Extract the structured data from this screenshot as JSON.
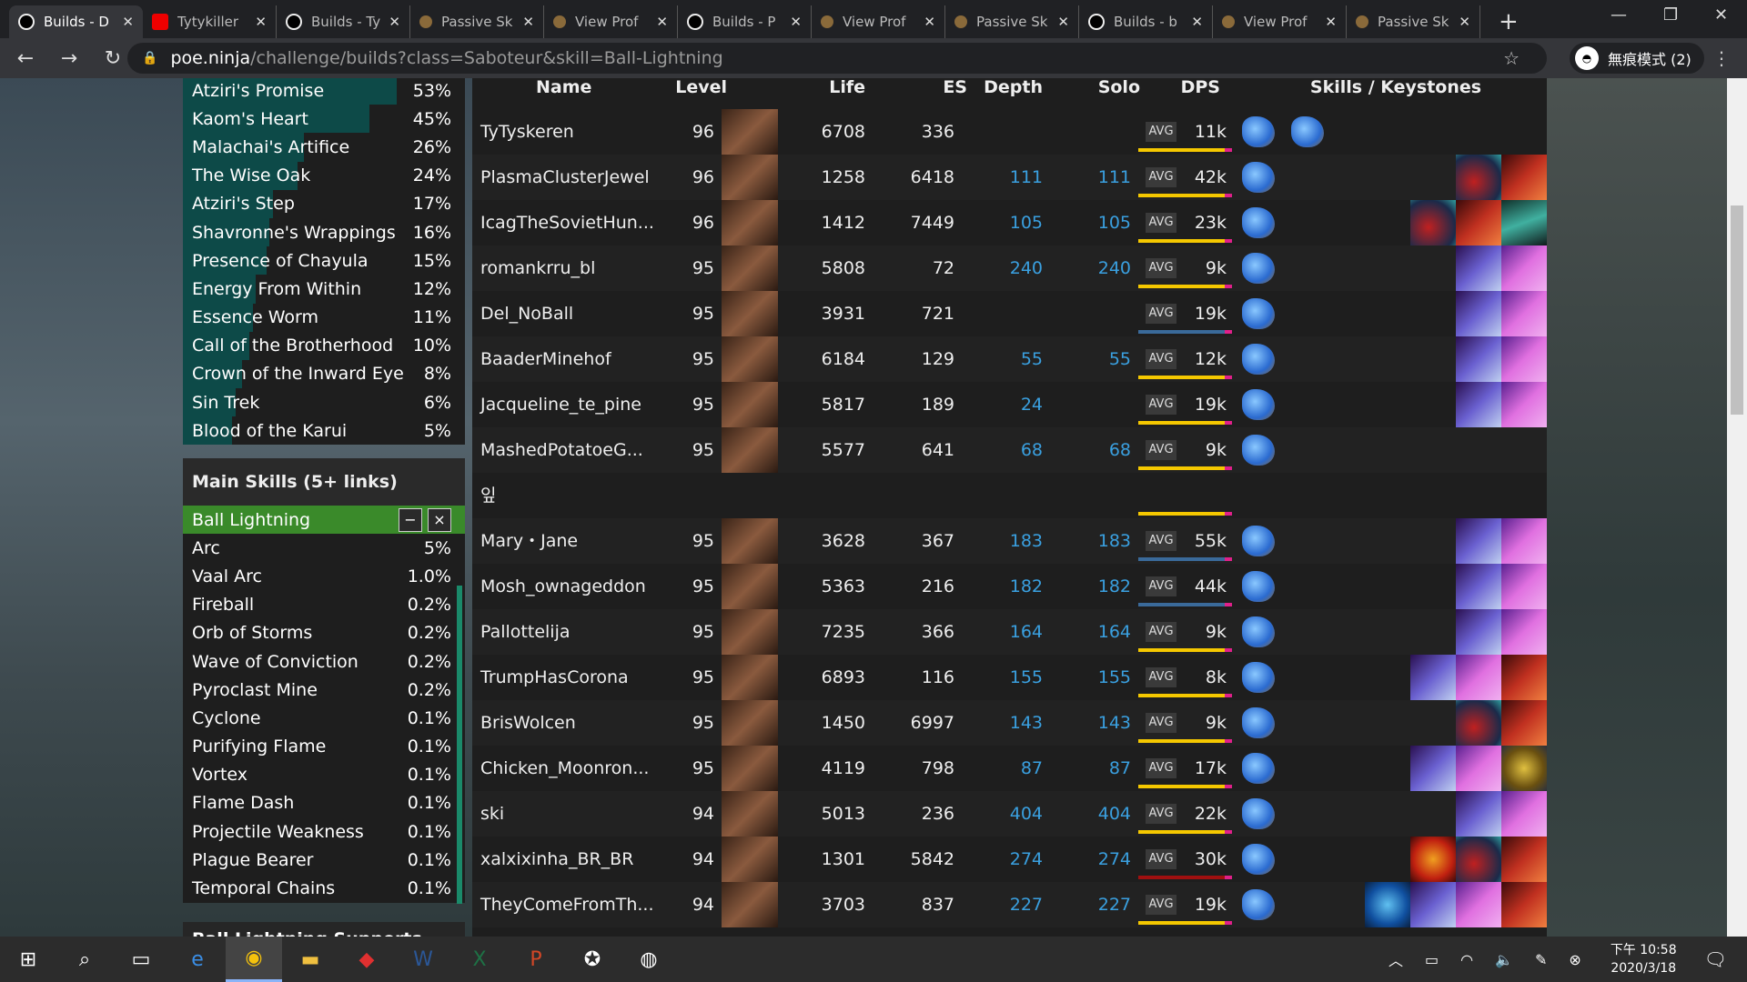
{
  "browser": {
    "tabs": [
      {
        "title": "Builds - D",
        "icon": "poe-ninja",
        "active": true
      },
      {
        "title": "Tytykiller",
        "icon": "youtube"
      },
      {
        "title": "Builds - Ty",
        "icon": "poe-ninja"
      },
      {
        "title": "Passive Sk",
        "icon": "poe"
      },
      {
        "title": "View Prof",
        "icon": "poe"
      },
      {
        "title": "Builds - P",
        "icon": "poe-ninja"
      },
      {
        "title": "View Prof",
        "icon": "poe"
      },
      {
        "title": "Passive Sk",
        "icon": "poe"
      },
      {
        "title": "Builds - b",
        "icon": "poe-ninja"
      },
      {
        "title": "View Prof",
        "icon": "poe"
      },
      {
        "title": "Passive Sk",
        "icon": "poe"
      }
    ],
    "url_host": "poe.ninja",
    "url_path": "/challenge/builds?class=Saboteur&skill=Ball-Lightning",
    "incognito_label": "無痕模式 (2)"
  },
  "uniques": [
    {
      "name": "Atziri's Promise",
      "pct": "53%"
    },
    {
      "name": "Kaom's Heart",
      "pct": "45%"
    },
    {
      "name": "Malachai's Artifice",
      "pct": "26%"
    },
    {
      "name": "The Wise Oak",
      "pct": "24%"
    },
    {
      "name": "Atziri's Step",
      "pct": "17%"
    },
    {
      "name": "Shavronne's Wrappings",
      "pct": "16%"
    },
    {
      "name": "Presence of Chayula",
      "pct": "15%"
    },
    {
      "name": "Energy From Within",
      "pct": "12%"
    },
    {
      "name": "Essence Worm",
      "pct": "11%"
    },
    {
      "name": "Call of the Brotherhood",
      "pct": "10%"
    },
    {
      "name": "Crown of the Inward Eye",
      "pct": "8%"
    },
    {
      "name": "Sin Trek",
      "pct": "6%"
    },
    {
      "name": "Blood of the Karui",
      "pct": "5%"
    }
  ],
  "main_skills": {
    "title": "Main Skills (5+ links)",
    "selected": "Ball Lightning",
    "minus": "−",
    "close": "×",
    "items": [
      {
        "name": "Arc",
        "pct": "5%"
      },
      {
        "name": "Vaal Arc",
        "pct": "1.0%"
      },
      {
        "name": "Fireball",
        "pct": "0.2%"
      },
      {
        "name": "Orb of Storms",
        "pct": "0.2%"
      },
      {
        "name": "Wave of Conviction",
        "pct": "0.2%"
      },
      {
        "name": "Pyroclast Mine",
        "pct": "0.2%"
      },
      {
        "name": "Cyclone",
        "pct": "0.1%"
      },
      {
        "name": "Purifying Flame",
        "pct": "0.1%"
      },
      {
        "name": "Vortex",
        "pct": "0.1%"
      },
      {
        "name": "Flame Dash",
        "pct": "0.1%"
      },
      {
        "name": "Projectile Weakness",
        "pct": "0.1%"
      },
      {
        "name": "Plague Bearer",
        "pct": "0.1%"
      },
      {
        "name": "Temporal Chains",
        "pct": "0.1%"
      }
    ]
  },
  "supports_title": "Ball Lightning Supports",
  "table": {
    "headers": [
      "Name",
      "Level",
      "Life",
      "ES",
      "Depth",
      "Solo",
      "DPS",
      "Skills / Keystones"
    ],
    "avg_label": "AVG",
    "rows": [
      {
        "name": "TyTyskeren",
        "level": "96",
        "life": "6708",
        "es": "336",
        "depth": "",
        "solo": "",
        "dps": "11k",
        "ks": []
      },
      {
        "name": "PlasmaClusterJewel",
        "level": "96",
        "life": "1258",
        "es": "6418",
        "depth": "111",
        "solo": "111",
        "dps": "42k",
        "ks": [
          "red",
          "fire"
        ]
      },
      {
        "name": "IcagTheSovietHun...",
        "level": "96",
        "life": "1412",
        "es": "7449",
        "depth": "105",
        "solo": "105",
        "dps": "23k",
        "ks": [
          "red",
          "fire",
          "teal"
        ]
      },
      {
        "name": "romankrru_bl",
        "level": "95",
        "life": "5808",
        "es": "72",
        "depth": "240",
        "solo": "240",
        "dps": "9k",
        "ks": [
          "blue",
          "pink"
        ]
      },
      {
        "name": "Del_NoBall",
        "level": "95",
        "life": "3931",
        "es": "721",
        "depth": "",
        "solo": "",
        "dps": "19k",
        "ks": [
          "blue",
          "pink"
        ]
      },
      {
        "name": "BaaderMinehof",
        "level": "95",
        "life": "6184",
        "es": "129",
        "depth": "55",
        "solo": "55",
        "dps": "12k",
        "ks": [
          "blue",
          "pink"
        ]
      },
      {
        "name": "Jacqueline_te_pine",
        "level": "95",
        "life": "5817",
        "es": "189",
        "depth": "24",
        "solo": "",
        "dps": "19k",
        "ks": [
          "blue",
          "pink"
        ]
      },
      {
        "name": "MashedPotatoeG...",
        "level": "95",
        "life": "5577",
        "es": "641",
        "depth": "68",
        "solo": "68",
        "dps": "9k",
        "ks": []
      },
      {
        "name": "잎",
        "level": "",
        "life": "",
        "es": "",
        "depth": "",
        "solo": "",
        "dps": "",
        "ks": [],
        "blank": true
      },
      {
        "name": "Mary・Jane",
        "level": "95",
        "life": "3628",
        "es": "367",
        "depth": "183",
        "solo": "183",
        "dps": "55k",
        "ks": [
          "blue",
          "pink"
        ]
      },
      {
        "name": "Mosh_ownageddon",
        "level": "95",
        "life": "5363",
        "es": "216",
        "depth": "182",
        "solo": "182",
        "dps": "44k",
        "ks": [
          "blue",
          "pink"
        ]
      },
      {
        "name": "Pallottelija",
        "level": "95",
        "life": "7235",
        "es": "366",
        "depth": "164",
        "solo": "164",
        "dps": "9k",
        "ks": [
          "blue",
          "pink"
        ]
      },
      {
        "name": "TrumpHasCorona",
        "level": "95",
        "life": "6893",
        "es": "116",
        "depth": "155",
        "solo": "155",
        "dps": "8k",
        "ks": [
          "blue",
          "pink",
          "fire"
        ]
      },
      {
        "name": "BrisWolcen",
        "level": "95",
        "life": "1450",
        "es": "6997",
        "depth": "143",
        "solo": "143",
        "dps": "9k",
        "ks": [
          "red",
          "fire"
        ]
      },
      {
        "name": "Chicken_Moonron...",
        "level": "95",
        "life": "4119",
        "es": "798",
        "depth": "87",
        "solo": "87",
        "dps": "17k",
        "ks": [
          "blue",
          "pink",
          "gold"
        ]
      },
      {
        "name": "ski",
        "level": "94",
        "life": "5013",
        "es": "236",
        "depth": "404",
        "solo": "404",
        "dps": "22k",
        "ks": [
          "blue",
          "pink"
        ]
      },
      {
        "name": "xalxixinha_BR_BR",
        "level": "94",
        "life": "1301",
        "es": "5842",
        "depth": "274",
        "solo": "274",
        "dps": "30k",
        "ks": [
          "orange",
          "red",
          "fire"
        ]
      },
      {
        "name": "TheyComeFromTh...",
        "level": "94",
        "life": "3703",
        "es": "837",
        "depth": "227",
        "solo": "227",
        "dps": "19k",
        "ks": [
          "cyan",
          "blue",
          "pink",
          "fire"
        ]
      }
    ]
  },
  "taskbar": {
    "clock_time": "下午 10:58",
    "clock_date": "2020/3/18"
  },
  "colors": {
    "accent_green": "#3a8a2a",
    "dps_bar": "#f5c800",
    "dps_marker": "#e0208a",
    "depth_blue": "#3aa0e0",
    "unique_bar": "#0d4a48"
  }
}
